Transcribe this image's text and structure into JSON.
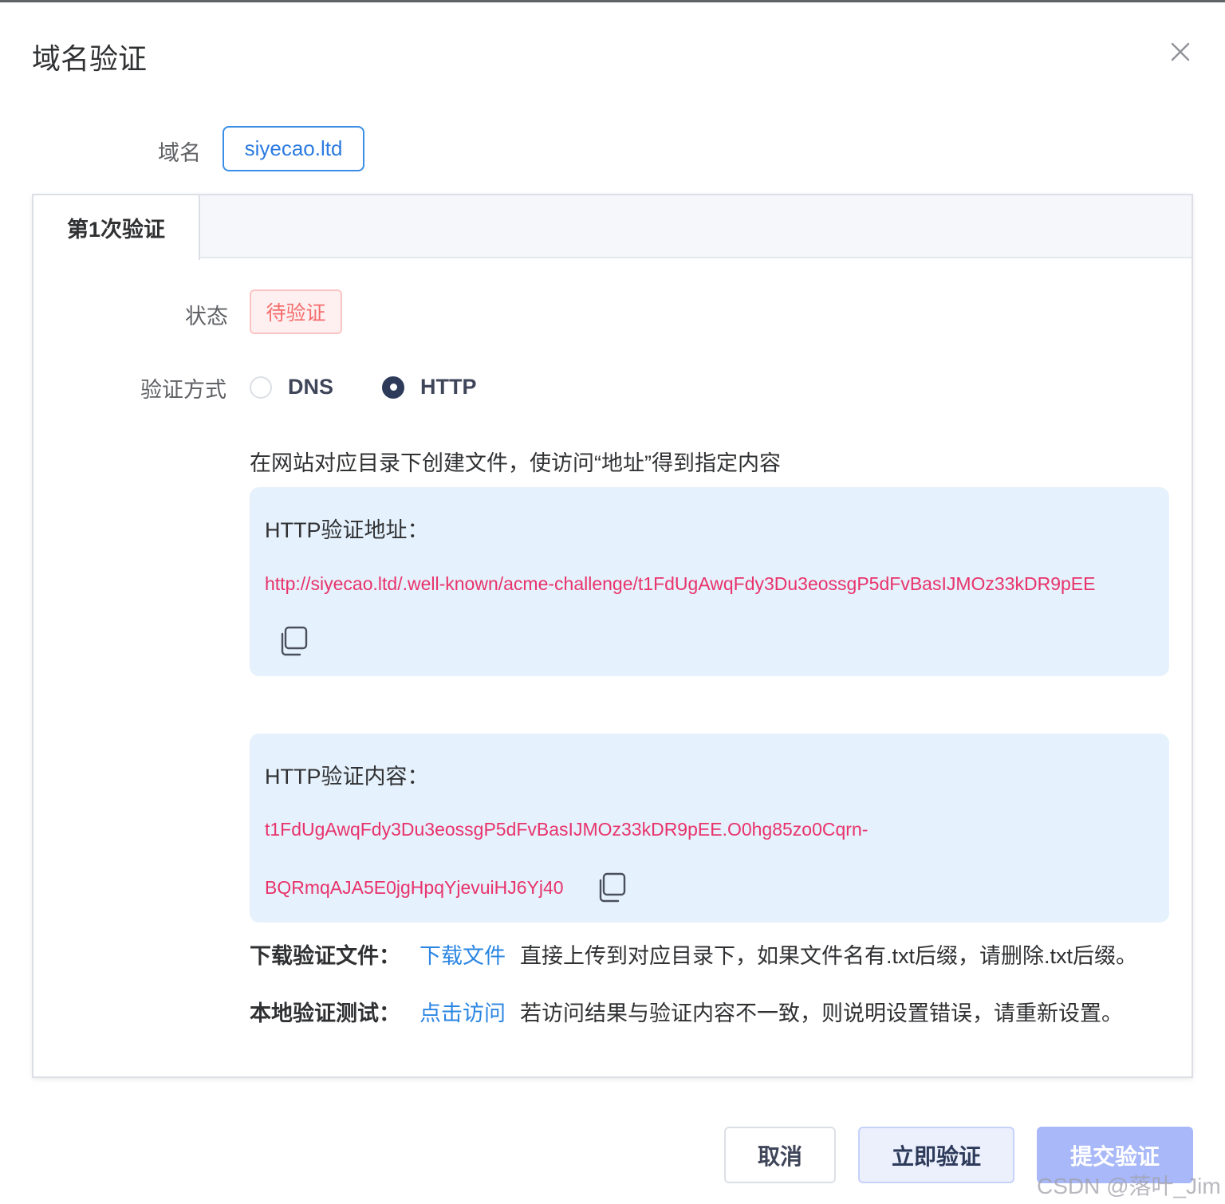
{
  "dialog": {
    "title": "域名验证",
    "close_icon": "close-icon"
  },
  "domain": {
    "label": "域名",
    "value": "siyecao.ltd"
  },
  "tabs": [
    {
      "label": "第1次验证",
      "active": true
    }
  ],
  "status": {
    "label": "状态",
    "value": "待验证"
  },
  "method": {
    "label": "验证方式",
    "options": [
      {
        "label": "DNS",
        "checked": false
      },
      {
        "label": "HTTP",
        "checked": true
      }
    ]
  },
  "hint": "在网站对应目录下创建文件，使访问“地址”得到指定内容",
  "http_address": {
    "title": "HTTP验证地址：",
    "value": "http://siyecao.ltd/.well-known/acme-challenge/t1FdUgAwqFdy3Du3eossgP5dFvBasIJMOz33kDR9pEE",
    "copy_icon": "copy-icon"
  },
  "http_content": {
    "title": "HTTP验证内容：",
    "value_line1": "t1FdUgAwqFdy3Du3eossgP5dFvBasIJMOz33kDR9pEE.O0hg85zo0Cqrn-",
    "value_line2": "BQRmqAJA5E0jgHpqYjevuiHJ6Yj40",
    "copy_icon": "copy-icon"
  },
  "download": {
    "label": "下载验证文件：",
    "link": "下载文件",
    "desc": "直接上传到对应目录下，如果文件名有.txt后缀，请删除.txt后缀。"
  },
  "local_test": {
    "label": "本地验证测试：",
    "link": "点击访问",
    "desc": "若访问结果与验证内容不一致，则说明设置错误，请重新设置。"
  },
  "footer": {
    "cancel": "取消",
    "verify_now": "立即验证",
    "submit": "提交验证"
  },
  "watermark": "CSDN @落叶_Jim",
  "colors": {
    "primary_link": "#2b86e3",
    "token_text": "#e8336b",
    "status_danger": "#f56c6c",
    "info_box_bg": "#e5f1fc",
    "submit_disabled": "#a8b8f8"
  }
}
